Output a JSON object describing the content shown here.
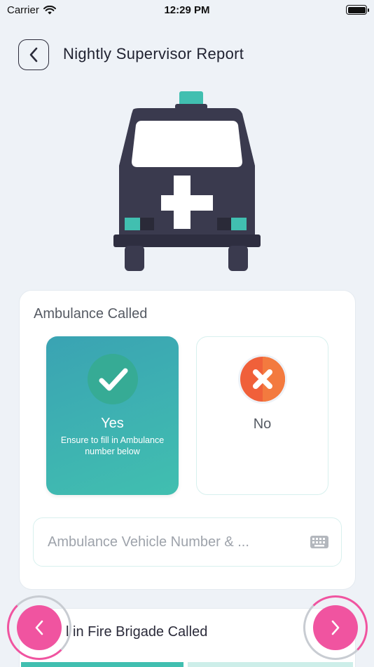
{
  "status_bar": {
    "carrier": "Carrier",
    "time": "12:29 PM"
  },
  "header": {
    "title": "Nightly Supervisor Report"
  },
  "ambulance_section": {
    "title": "Ambulance Called",
    "yes": {
      "label": "Yes",
      "note": "Ensure to fill in Ambulance number below",
      "selected": true
    },
    "no": {
      "label": "No",
      "selected": false
    },
    "vehicle_input": {
      "placeholder": "Ambulance Vehicle Number & ...",
      "value": ""
    }
  },
  "fire_section": {
    "title": "l in Fire Brigade Called"
  },
  "colors": {
    "accent_pink": "#f054a0",
    "teal": "#41bfb0",
    "navy": "#3a3a4e",
    "no_orange": "#f0603a"
  },
  "icons": [
    "back-chevron-icon",
    "ambulance-illustration",
    "check-icon",
    "x-icon",
    "keyboard-icon",
    "chevron-left-icon",
    "chevron-right-icon",
    "wifi-icon",
    "battery-icon"
  ]
}
